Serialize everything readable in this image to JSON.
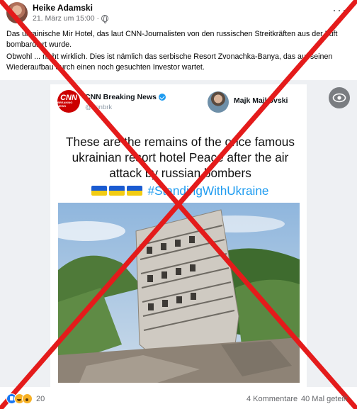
{
  "post": {
    "author": "Heike Adamski",
    "timestamp": "21. März um 15:00 ·",
    "privacy_icon": "globe-icon",
    "paragraphs": [
      "Das ukrainische Mir Hotel, das laut CNN-Journalisten von den russischen Streitkräften aus der Luft bombardiert wurde.",
      "Obwohl ... nicht wirklich. Dies ist nämlich das serbische Resort Zvonachka-Banya, das auf seinen Wiederaufbau durch einen noch gesuchten Investor wartet."
    ]
  },
  "tweet": {
    "logo_big": "CNN",
    "logo_small": "BREAKING NEWS",
    "account_name": "CNN Breaking News",
    "handle": "@cnnbrk",
    "reply_name": "Majk Majkovski",
    "text": "These are the remains of the once famous ukrainian resort hotel Peace after the air attack by russian bombers",
    "hashtag": "#StandingWithUkraine",
    "flag_count": 3
  },
  "overlay": {
    "cross_color": "#e41b1b"
  },
  "footer": {
    "reaction_icons": [
      "like-icon",
      "haha-icon",
      "wow-icon"
    ],
    "reaction_count": "20",
    "comments": "4 Kommentare",
    "shares": "40 Mal geteilt"
  }
}
